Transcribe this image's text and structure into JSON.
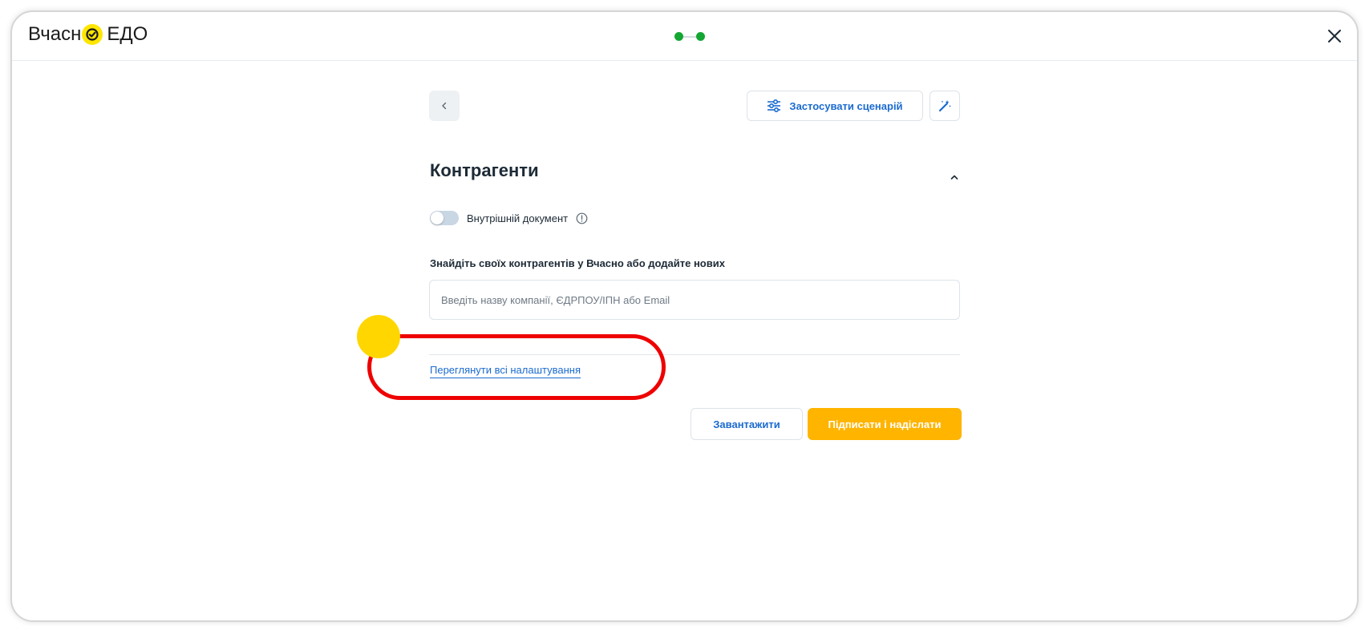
{
  "header": {
    "logo_prefix": "Вчасн",
    "logo_suffix": "ЕДО",
    "close_icon": "close-icon"
  },
  "toolbar": {
    "back_icon": "chevron-left-icon",
    "scenario_label": "Застосувати сценарій",
    "scenario_icon": "sliders-icon",
    "magic_icon": "magic-wand-icon"
  },
  "section": {
    "title": "Контрагенти",
    "collapse_icon": "chevron-up-icon",
    "internal_doc_label": "Внутрішній документ",
    "internal_doc_enabled": false,
    "info_icon": "info-icon"
  },
  "search": {
    "label": "Знайдіть своїх контрагентів у Вчасно або додайте нових",
    "placeholder": "Введіть назву компанії, ЄДРПОУ/ІПН або Email",
    "value": ""
  },
  "links": {
    "all_settings": "Переглянути всі налаштування"
  },
  "actions": {
    "download": "Завантажити",
    "sign_and_send": "Підписати і надіслати"
  },
  "colors": {
    "accent_blue": "#1b6bd0",
    "primary_orange": "#ffb400",
    "progress_green": "#14a632",
    "logo_yellow": "#ffe500",
    "annotation_red": "#ee0000",
    "annotation_yellow": "#ffd600"
  },
  "progress": {
    "steps_total": 2,
    "steps_done": 2
  }
}
